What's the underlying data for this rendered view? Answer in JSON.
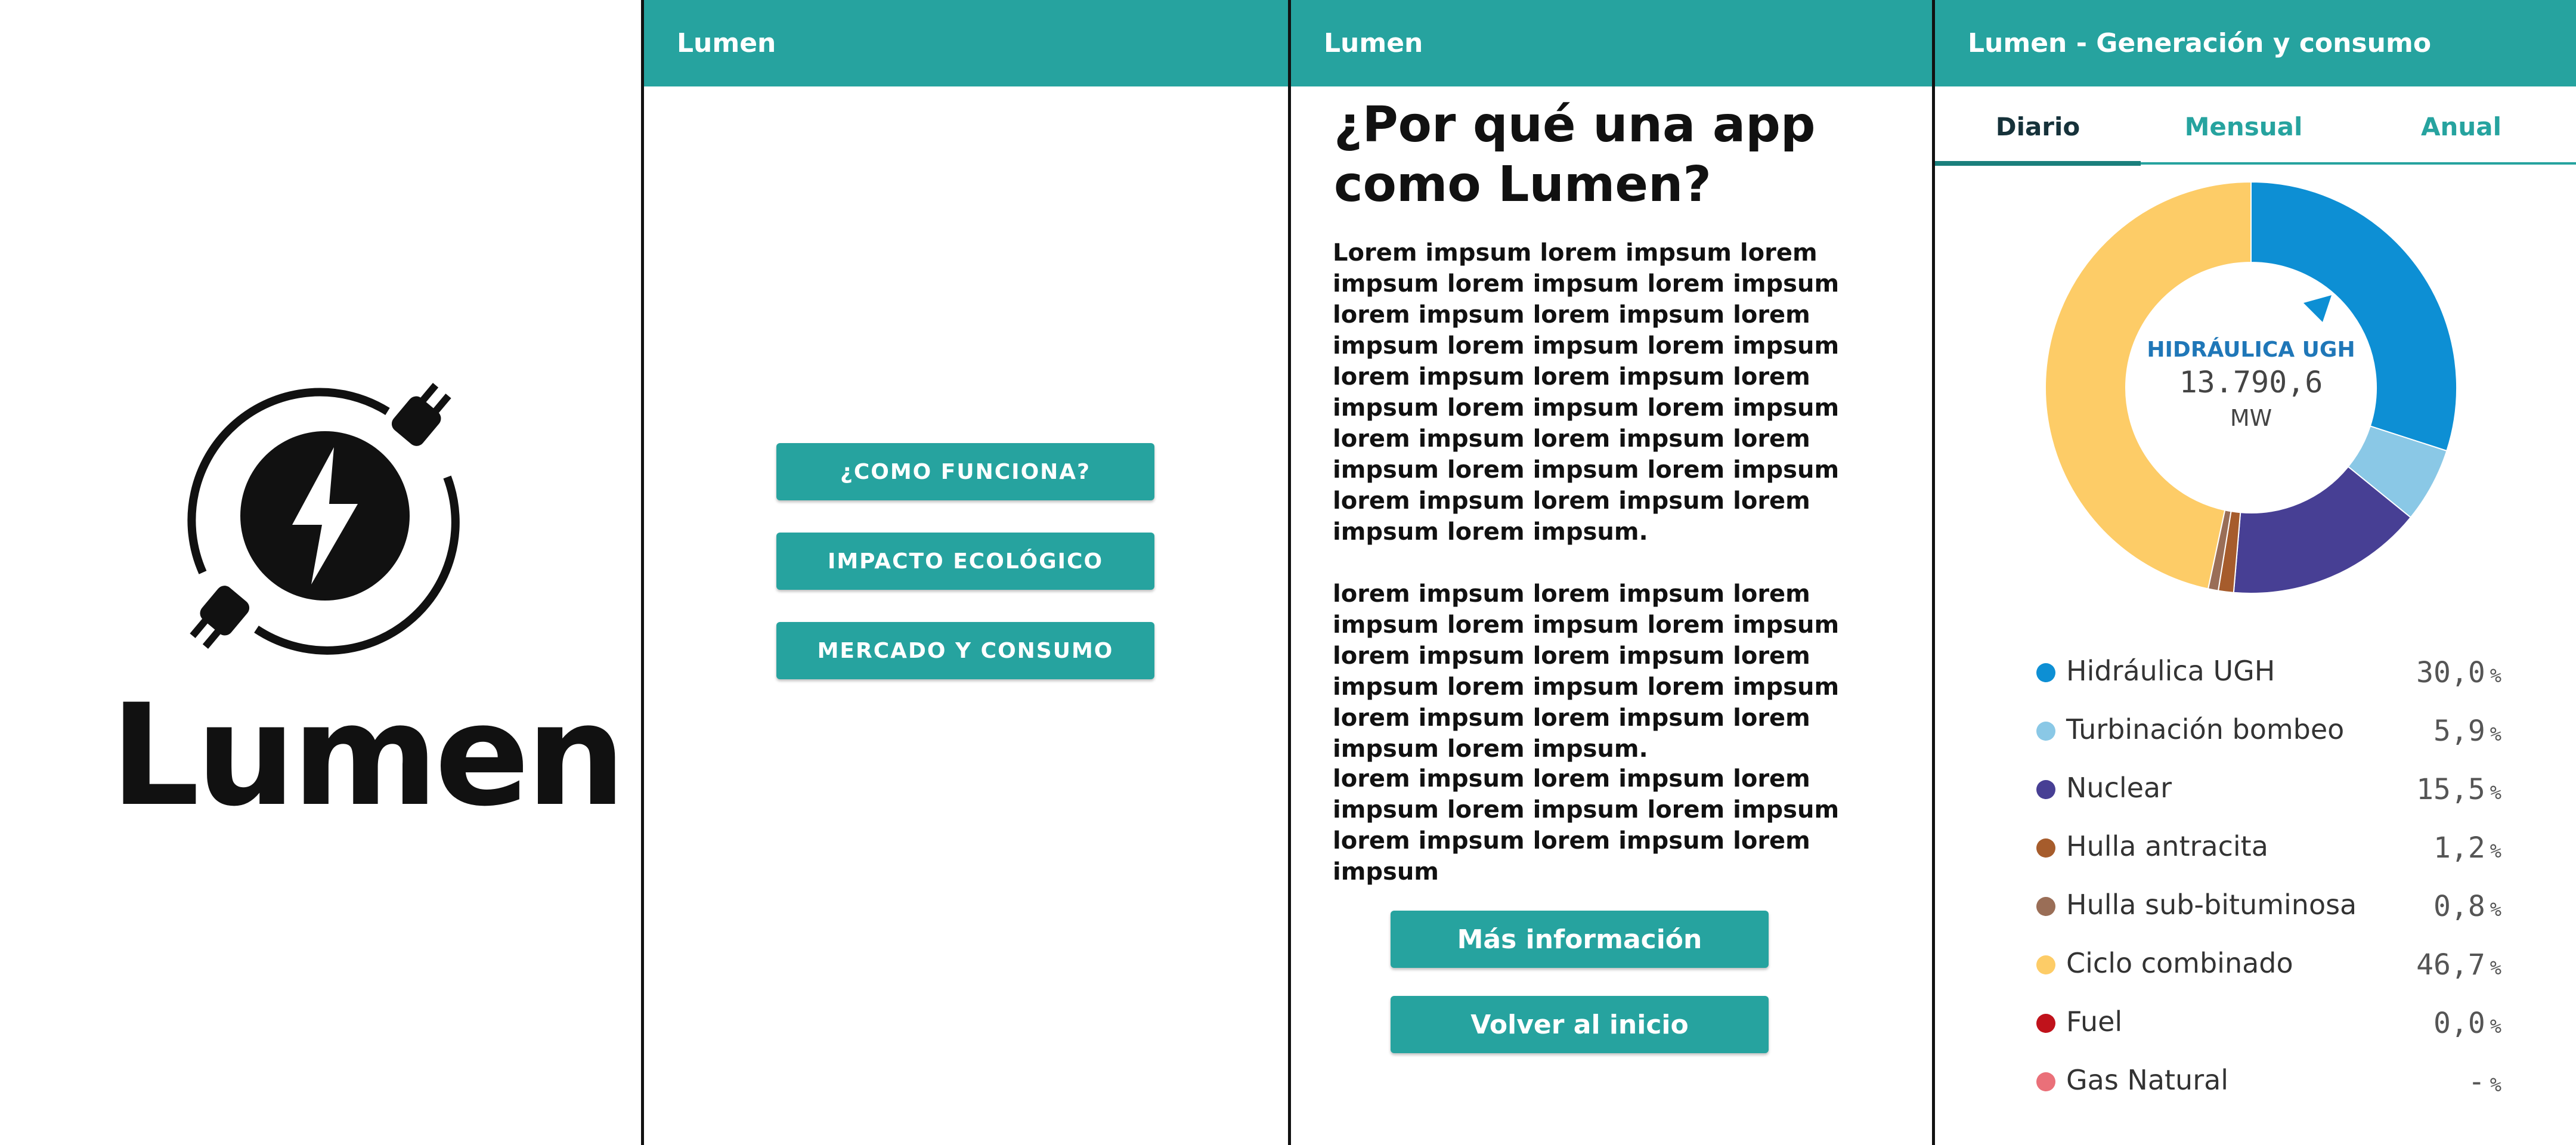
{
  "splash": {
    "logo_text": "Lumen"
  },
  "menu": {
    "title": "Lumen",
    "buttons": [
      "¿COMO FUNCIONA?",
      "IMPACTO ECOLÓGICO",
      "MERCADO Y CONSUMO"
    ]
  },
  "info": {
    "app_title": "Lumen",
    "heading": "¿Por qué una app como Lumen?",
    "paragraphs": [
      "Lorem impsum lorem impsum lorem impsum lorem impsum lorem impsum lorem impsum lorem impsum lorem impsum lorem impsum lorem impsum lorem impsum lorem impsum lorem impsum lorem impsum lorem impsum lorem impsum lorem impsum lorem impsum lorem impsum lorem impsum lorem impsum lorem impsum lorem impsum lorem impsum.",
      "lorem impsum lorem impsum lorem impsum lorem impsum lorem impsum lorem impsum lorem impsum lorem impsum lorem impsum lorem impsum lorem impsum lorem impsum lorem impsum lorem impsum.",
      "lorem impsum lorem impsum lorem impsum lorem impsum lorem impsum lorem impsum lorem impsum lorem impsum"
    ],
    "more_button": "Más información",
    "back_button": "Volver al inicio"
  },
  "chart_panel": {
    "title": "Lumen - Generación y consumo",
    "tabs": [
      "Diario",
      "Mensual",
      "Anual"
    ],
    "active_tab": "Diario",
    "center_label": "HIDRÁULICA UGH",
    "center_value": "13.790,6",
    "center_unit": "MW"
  },
  "chart_data": {
    "type": "pie",
    "donut": true,
    "unit": "%",
    "slices": [
      {
        "name": "Hidráulica UGH",
        "value": 30.0,
        "display": "30,0",
        "color": "#0d8fd4"
      },
      {
        "name": "Turbinación bombeo",
        "value": 5.9,
        "display": "5,9",
        "color": "#8ac8e6"
      },
      {
        "name": "Nuclear",
        "value": 15.5,
        "display": "15,5",
        "color": "#473f94"
      },
      {
        "name": "Hulla antracita",
        "value": 1.2,
        "display": "1,2",
        "color": "#a65c2c"
      },
      {
        "name": "Hulla sub-bituminosa",
        "value": 0.8,
        "display": "0,8",
        "color": "#9a6e57"
      },
      {
        "name": "Ciclo combinado",
        "value": 46.7,
        "display": "46,7",
        "color": "#fdcc67"
      },
      {
        "name": "Fuel",
        "value": 0.0,
        "display": "0,0",
        "color": "#c0121b"
      },
      {
        "name": "Gas Natural",
        "value": null,
        "display": "-",
        "color": "#ea7079"
      }
    ]
  }
}
